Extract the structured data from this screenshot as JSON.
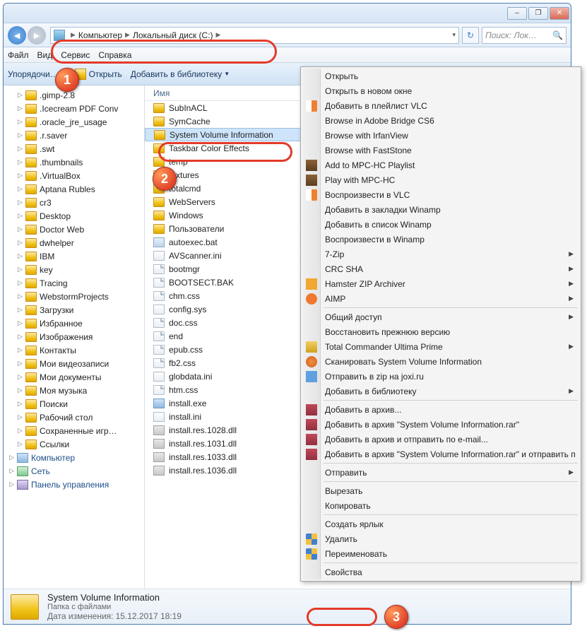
{
  "titlebar": {
    "min": "–",
    "max": "❐",
    "close": "✕"
  },
  "nav": {
    "path": [
      "Компьютер",
      "Локальный диск (C:)"
    ],
    "refresh": "↻",
    "search_placeholder": "Поиск: Лок…",
    "search_icon": "🔍"
  },
  "menu": {
    "file": "Файл",
    "view": "Вид",
    "service": "Сервис",
    "help": "Справка"
  },
  "toolbar": {
    "arrange": "Упорядочи…",
    "open": "Открыть",
    "library": "Добавить в библиотеку"
  },
  "tree": [
    ".gimp-2.8",
    ".Icecream PDF Conv",
    ".oracle_jre_usage",
    ".r.saver",
    ".swt",
    ".thumbnails",
    ".VirtualBox",
    "Aptana Rubles",
    "cr3",
    "Desktop",
    "Doctor Web",
    "dwhelper",
    "IBM",
    "key",
    "Tracing",
    "WebstormProjects",
    "Загрузки",
    "Избранное",
    "Изображения",
    "Контакты",
    "Мои видеозаписи",
    "Мои документы",
    "Моя музыка",
    "Поиски",
    "Рабочий стол",
    "Сохраненные игр…",
    "Ссылки"
  ],
  "tree_footer": [
    {
      "label": "Компьютер",
      "cls": "computer"
    },
    {
      "label": "Сеть",
      "cls": "net"
    },
    {
      "label": "Панель управления",
      "cls": "cp"
    }
  ],
  "list_header": "Имя",
  "files_top": [
    {
      "n": "SubInACL",
      "t": "folder"
    },
    {
      "n": "SymCache",
      "t": "folder",
      "clip": true
    }
  ],
  "selected_file": "System Volume Information",
  "files_bottom": [
    {
      "n": "Taskbar Color Effects",
      "t": "folder",
      "clip": true
    },
    {
      "n": "temp",
      "t": "folder",
      "clip": true
    },
    {
      "n": "textures",
      "t": "folder"
    },
    {
      "n": "totalcmd",
      "t": "folder"
    },
    {
      "n": "WebServers",
      "t": "folder"
    },
    {
      "n": "Windows",
      "t": "folder"
    },
    {
      "n": "Пользователи",
      "t": "folder"
    },
    {
      "n": "autoexec.bat",
      "t": "bat"
    },
    {
      "n": "AVScanner.ini",
      "t": "ini"
    },
    {
      "n": "bootmgr",
      "t": "file"
    },
    {
      "n": "BOOTSECT.BAK",
      "t": "file"
    },
    {
      "n": "chm.css",
      "t": "file"
    },
    {
      "n": "config.sys",
      "t": "ini"
    },
    {
      "n": "doc.css",
      "t": "file"
    },
    {
      "n": "end",
      "t": "file"
    },
    {
      "n": "epub.css",
      "t": "file"
    },
    {
      "n": "fb2.css",
      "t": "file"
    },
    {
      "n": "globdata.ini",
      "t": "ini"
    },
    {
      "n": "htm.css",
      "t": "file"
    },
    {
      "n": "install.exe",
      "t": "exe"
    },
    {
      "n": "install.ini",
      "t": "ini"
    },
    {
      "n": "install.res.1028.dll",
      "t": "dll"
    },
    {
      "n": "install.res.1031.dll",
      "t": "dll"
    },
    {
      "n": "install.res.1033.dll",
      "t": "dll"
    },
    {
      "n": "install.res.1036.dll",
      "t": "dll"
    }
  ],
  "details": {
    "title": "System Volume Information",
    "type": "Папка с файлами",
    "date_label": "Дата изменения:",
    "date": "15.12.2017 18:19"
  },
  "context": [
    {
      "t": "item",
      "label": "Открыть"
    },
    {
      "t": "item",
      "label": "Открыть в новом окне"
    },
    {
      "t": "item",
      "label": "Добавить в плейлист VLC",
      "icon": "vlc"
    },
    {
      "t": "item",
      "label": "Browse in Adobe Bridge CS6"
    },
    {
      "t": "item",
      "label": "Browse with IrfanView"
    },
    {
      "t": "item",
      "label": "Browse with FastStone"
    },
    {
      "t": "item",
      "label": "Add to MPC-HC Playlist",
      "icon": "mpc"
    },
    {
      "t": "item",
      "label": "Play with MPC-HC",
      "icon": "mpc"
    },
    {
      "t": "item",
      "label": "Воспроизвести в VLC",
      "icon": "vlc"
    },
    {
      "t": "item",
      "label": "Добавить в закладки Winamp"
    },
    {
      "t": "item",
      "label": "Добавить в список Winamp"
    },
    {
      "t": "item",
      "label": "Воспроизвести в Winamp"
    },
    {
      "t": "item",
      "label": "7-Zip",
      "sub": true
    },
    {
      "t": "item",
      "label": "CRC SHA",
      "sub": true
    },
    {
      "t": "item",
      "label": "Hamster ZIP Archiver",
      "icon": "h7z",
      "sub": true
    },
    {
      "t": "item",
      "label": "AIMP",
      "icon": "aimp",
      "sub": true
    },
    {
      "t": "sep"
    },
    {
      "t": "item",
      "label": "Общий доступ",
      "sub": true
    },
    {
      "t": "item",
      "label": "Восстановить прежнюю версию"
    },
    {
      "t": "item",
      "label": "Total Commander Ultima Prime",
      "icon": "tc",
      "sub": true
    },
    {
      "t": "item",
      "label": "Сканировать System Volume Information",
      "icon": "avast"
    },
    {
      "t": "item",
      "label": "Отправить в zip на joxi.ru",
      "icon": "joxi"
    },
    {
      "t": "item",
      "label": "Добавить в библиотеку",
      "sub": true
    },
    {
      "t": "sep"
    },
    {
      "t": "item",
      "label": "Добавить в архив...",
      "icon": "rar"
    },
    {
      "t": "item",
      "label": "Добавить в архив \"System Volume Information.rar\"",
      "icon": "rar"
    },
    {
      "t": "item",
      "label": "Добавить в архив и отправить по e-mail...",
      "icon": "rar"
    },
    {
      "t": "item",
      "label": "Добавить в архив \"System Volume Information.rar\" и отправить п",
      "icon": "rar"
    },
    {
      "t": "sep"
    },
    {
      "t": "item",
      "label": "Отправить",
      "sub": true
    },
    {
      "t": "sep"
    },
    {
      "t": "item",
      "label": "Вырезать"
    },
    {
      "t": "item",
      "label": "Копировать"
    },
    {
      "t": "sep"
    },
    {
      "t": "item",
      "label": "Создать ярлык"
    },
    {
      "t": "item",
      "label": "Удалить",
      "icon": "shield"
    },
    {
      "t": "item",
      "label": "Переименовать",
      "icon": "shield"
    },
    {
      "t": "sep"
    },
    {
      "t": "item",
      "label": "Свойства",
      "hl": true
    }
  ],
  "badges": {
    "b1": "1",
    "b2": "2",
    "b3": "3"
  }
}
